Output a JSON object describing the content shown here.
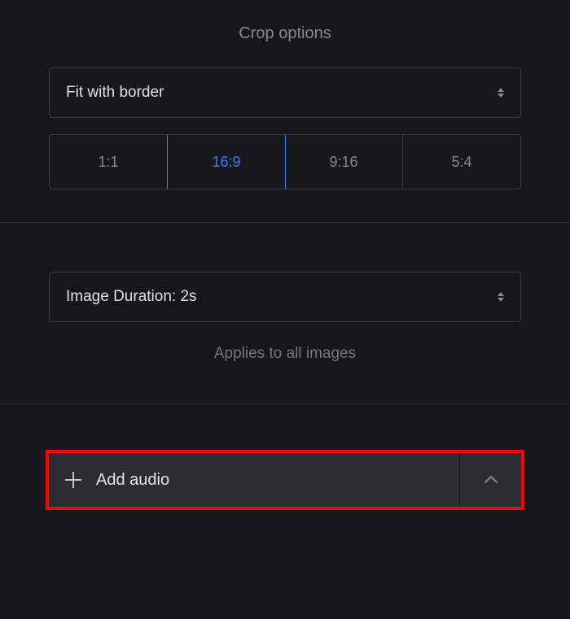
{
  "crop": {
    "title": "Crop options",
    "fit_mode": "Fit with border",
    "ratios": [
      {
        "label": "1:1",
        "selected": false
      },
      {
        "label": "16:9",
        "selected": true
      },
      {
        "label": "9:16",
        "selected": false
      },
      {
        "label": "5:4",
        "selected": false
      }
    ]
  },
  "duration": {
    "label": "Image Duration: 2s",
    "hint": "Applies to all images"
  },
  "audio": {
    "add_label": "Add audio"
  }
}
